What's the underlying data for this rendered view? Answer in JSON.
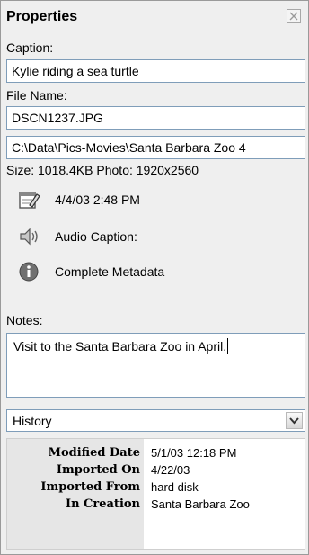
{
  "panel": {
    "title": "Properties",
    "close_icon": "close-icon"
  },
  "caption": {
    "label": "Caption:",
    "value": "Kylie riding a sea turtle"
  },
  "file_name": {
    "label": "File Name:",
    "value": "DSCN1237.JPG",
    "path": "C:\\Data\\Pics-Movies\\Santa Barbara Zoo 4"
  },
  "size_line": "Size: 1018.4KB  Photo: 1920x2560",
  "info_rows": {
    "date": {
      "icon": "calendar-edit-icon",
      "text": "4/4/03 2:48 PM"
    },
    "audio": {
      "icon": "speaker-icon",
      "text": "Audio Caption:"
    },
    "metadata": {
      "icon": "info-icon",
      "text": "Complete Metadata"
    }
  },
  "notes": {
    "label": "Notes:",
    "value": "Visit to the Santa Barbara Zoo in April."
  },
  "history_select": {
    "selected": "History",
    "icon": "chevron-down-icon"
  },
  "history": [
    {
      "label": "Modified Date",
      "value": "5/1/03 12:18 PM"
    },
    {
      "label": "Imported On",
      "value": "4/22/03"
    },
    {
      "label": "Imported From",
      "value": "hard disk"
    },
    {
      "label": "In Creation",
      "value": "Santa Barbara Zoo"
    }
  ]
}
